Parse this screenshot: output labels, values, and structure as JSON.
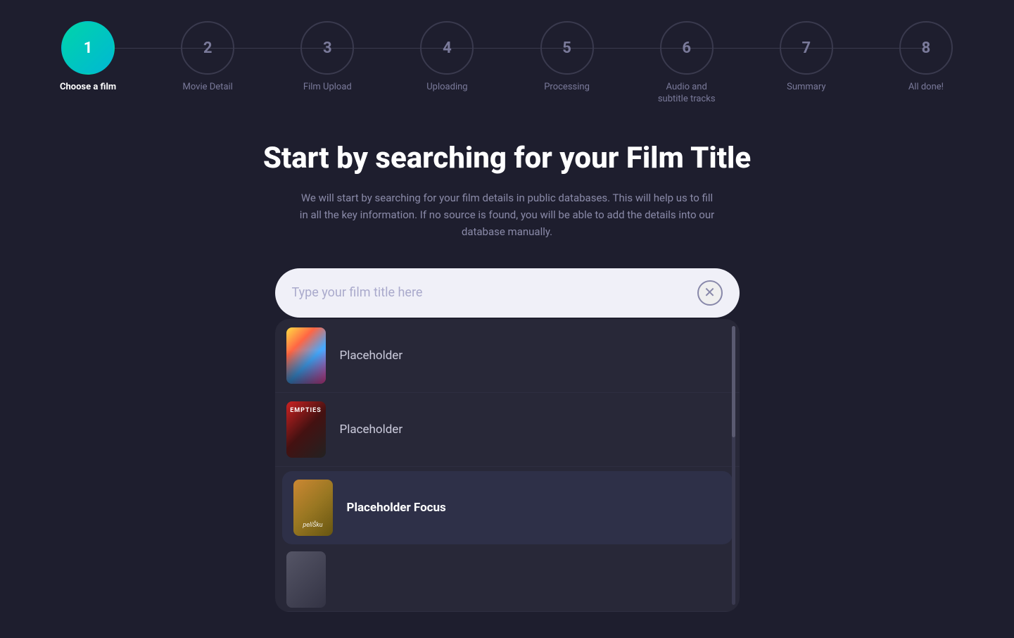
{
  "stepper": {
    "steps": [
      {
        "number": "1",
        "label": "Choose a film",
        "active": true
      },
      {
        "number": "2",
        "label": "Movie Detail",
        "active": false
      },
      {
        "number": "3",
        "label": "Film Upload",
        "active": false
      },
      {
        "number": "4",
        "label": "Uploading",
        "active": false
      },
      {
        "number": "5",
        "label": "Processing",
        "active": false
      },
      {
        "number": "6",
        "label": "Audio and subtitle tracks",
        "active": false
      },
      {
        "number": "7",
        "label": "Summary",
        "active": false
      },
      {
        "number": "8",
        "label": "All done!",
        "active": false
      }
    ]
  },
  "page": {
    "title": "Start by searching for your Film Title",
    "subtitle": "We will start by searching for your film details in public databases. This will help us to fill in all the key information. If no source is found, you will be able to add the details into our database manually."
  },
  "search": {
    "placeholder": "Type your film title here",
    "clear_label": "×"
  },
  "results": [
    {
      "id": 1,
      "label": "Placeholder",
      "focused": false,
      "poster_type": "poster-1"
    },
    {
      "id": 2,
      "label": "Placeholder",
      "focused": false,
      "poster_type": "poster-2"
    },
    {
      "id": 3,
      "label": "Placeholder Focus",
      "focused": true,
      "poster_type": "poster-3"
    },
    {
      "id": 4,
      "label": "",
      "focused": false,
      "poster_type": "poster-4"
    }
  ]
}
